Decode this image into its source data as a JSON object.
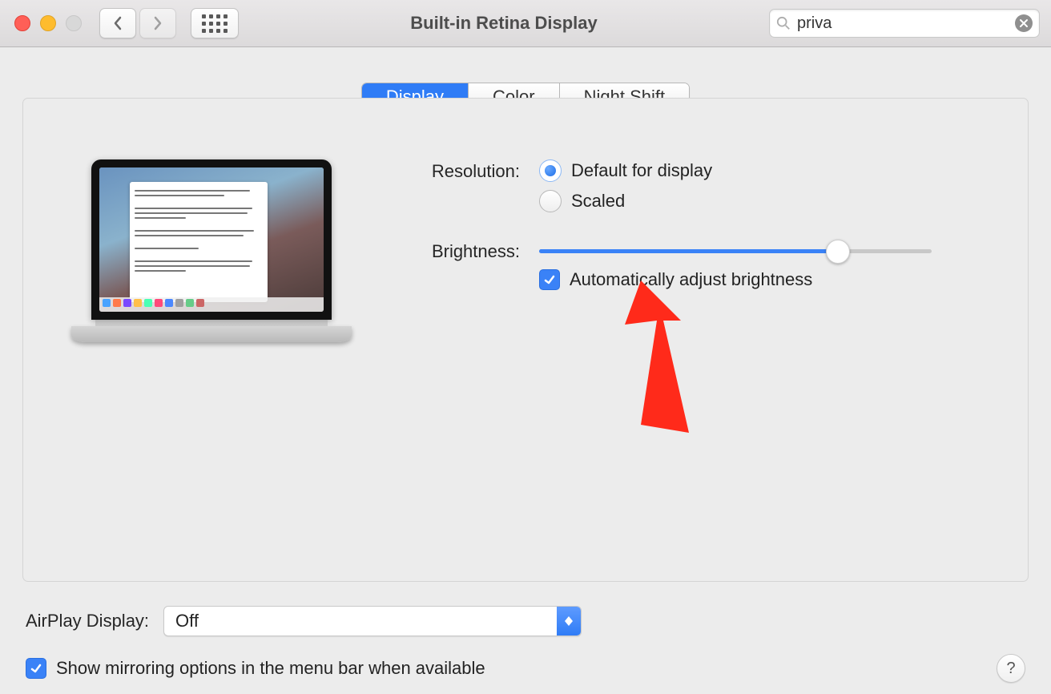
{
  "window": {
    "title": "Built-in Retina Display"
  },
  "search": {
    "value": "priva"
  },
  "tabs": {
    "display": "Display",
    "color": "Color",
    "night_shift": "Night Shift"
  },
  "settings": {
    "resolution_label": "Resolution:",
    "resolution_default": "Default for display",
    "resolution_scaled": "Scaled",
    "brightness_label": "Brightness:",
    "brightness_value_pct": 76,
    "auto_brightness_label": "Automatically adjust brightness"
  },
  "airplay": {
    "label": "AirPlay Display:",
    "value": "Off"
  },
  "mirroring": {
    "label": "Show mirroring options in the menu bar when available"
  },
  "help": {
    "label": "?"
  }
}
